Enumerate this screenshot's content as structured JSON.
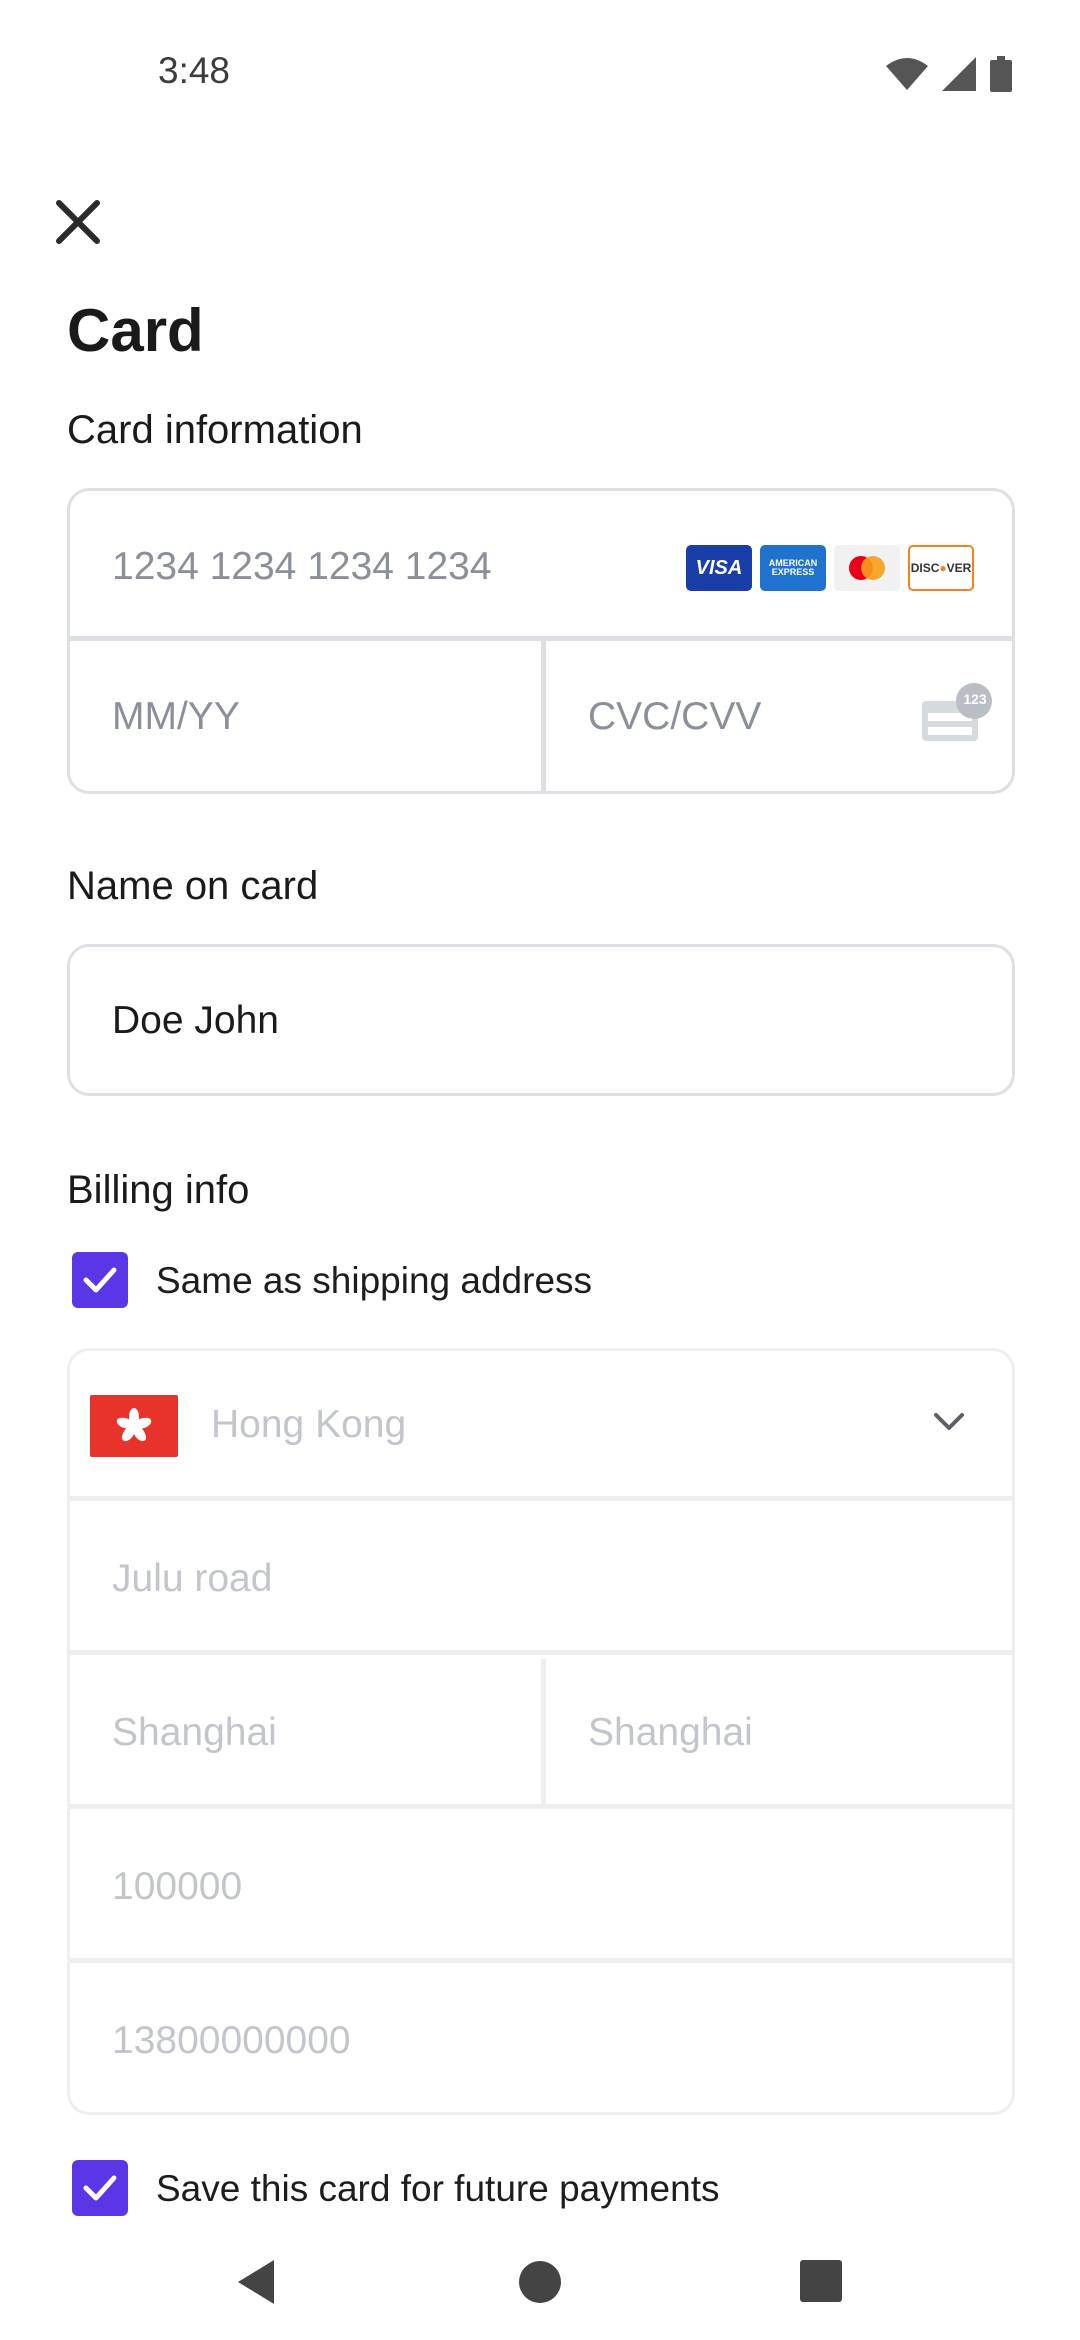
{
  "status_bar": {
    "time": "3:48",
    "icons": [
      "wifi-icon",
      "signal-icon",
      "battery-icon"
    ]
  },
  "header": {
    "close_icon": "close-icon",
    "title": "Card"
  },
  "card_information": {
    "label": "Card information",
    "card_number_placeholder": "1234 1234 1234 1234",
    "expiry_placeholder": "MM/YY",
    "cvc_placeholder": "CVC/CVV",
    "cvc_icon_badge": "123",
    "brands": [
      {
        "name": "VISA",
        "color": "#1a3ea8"
      },
      {
        "name": "AMERICAN EXPRESS",
        "color": "#1f72cd"
      },
      {
        "name": "mastercard",
        "color": "#eb001b"
      },
      {
        "name": "DISCOVER",
        "color": "#f58220"
      }
    ]
  },
  "name_on_card": {
    "label": "Name on card",
    "value": "Doe John"
  },
  "billing": {
    "label": "Billing info",
    "same_as_shipping_label": "Same as shipping address",
    "same_as_shipping_checked": true,
    "country": "Hong Kong",
    "address_line": "Julu road",
    "city": "Shanghai",
    "state": "Shanghai",
    "postal_code": "100000",
    "phone": "13800000000"
  },
  "save_card": {
    "label": "Save this card for future payments",
    "checked": true
  },
  "colors": {
    "accent": "#5b36e6",
    "border": "#dcdfe3",
    "hk_flag": "#e8332a"
  }
}
